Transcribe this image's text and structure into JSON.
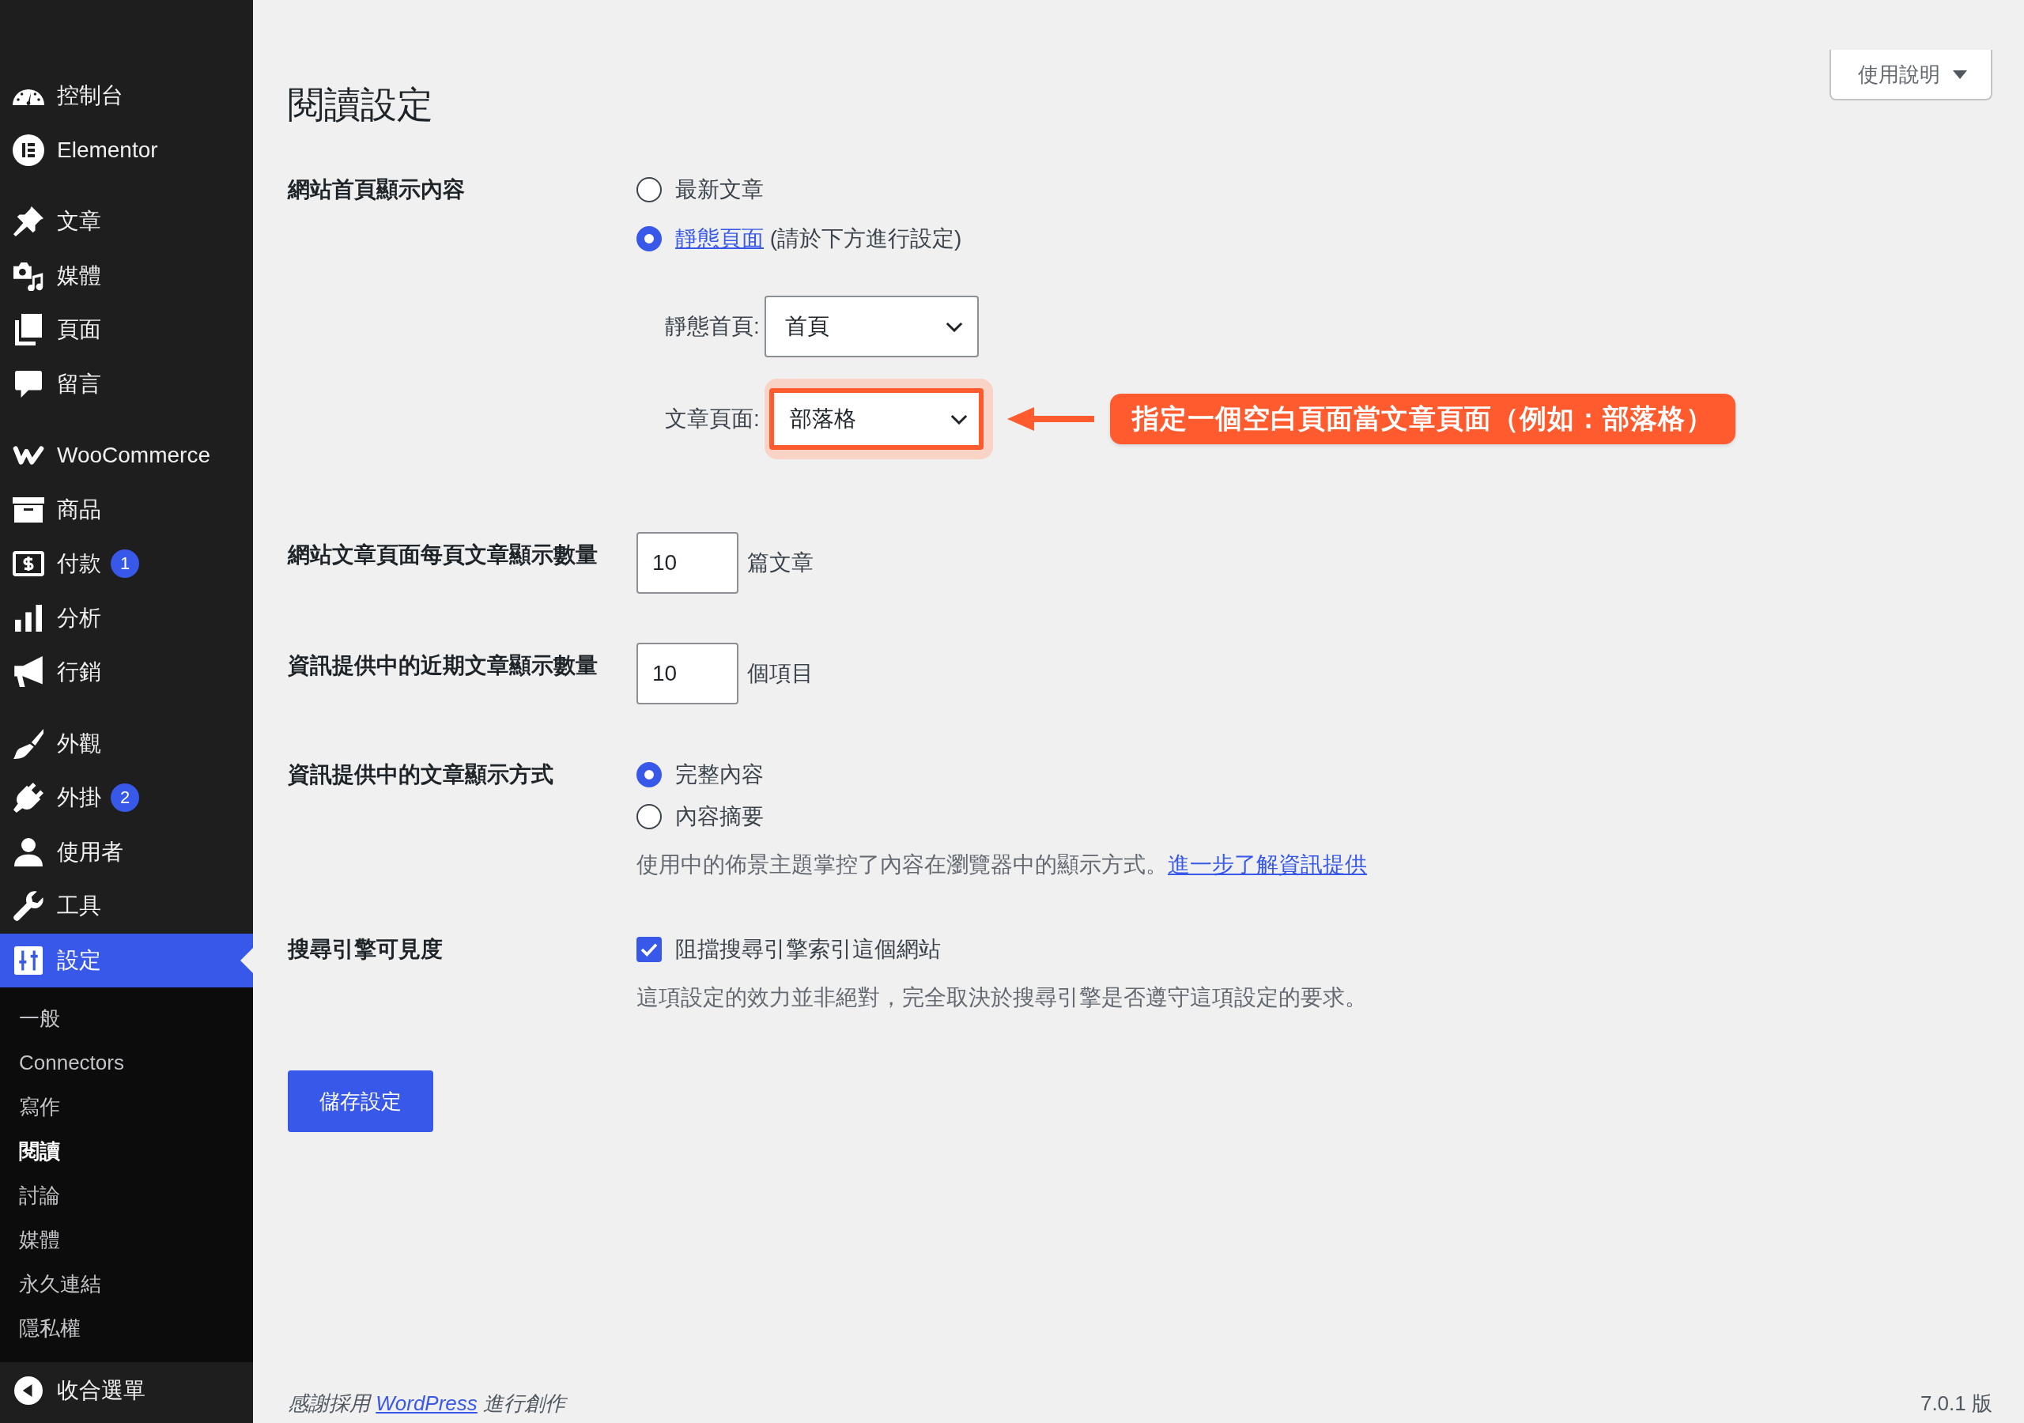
{
  "sidebar": {
    "groups": [
      {
        "items": [
          {
            "label": "控制台",
            "selected": false
          },
          {
            "label": "Elementor",
            "selected": false
          }
        ]
      },
      {
        "items": [
          {
            "label": "文章",
            "selected": false
          },
          {
            "label": "媒體",
            "selected": false
          },
          {
            "label": "頁面",
            "selected": false
          },
          {
            "label": "留言",
            "selected": false
          }
        ]
      },
      {
        "items": [
          {
            "label": "WooCommerce",
            "selected": false
          },
          {
            "label": "商品",
            "selected": false
          },
          {
            "label": "付款",
            "selected": false,
            "badge": "1"
          },
          {
            "label": "分析",
            "selected": false
          },
          {
            "label": "行銷",
            "selected": false
          }
        ]
      },
      {
        "items": [
          {
            "label": "外觀",
            "selected": false
          },
          {
            "label": "外掛",
            "selected": false,
            "badge": "2"
          },
          {
            "label": "使用者",
            "selected": false
          },
          {
            "label": "工具",
            "selected": false
          },
          {
            "label": "設定",
            "selected": true,
            "children": [
              {
                "label": "一般",
                "selected": false
              },
              {
                "label": "Connectors",
                "selected": false
              },
              {
                "label": "寫作",
                "selected": false
              },
              {
                "label": "閱讀",
                "selected": true
              },
              {
                "label": "討論",
                "selected": false
              },
              {
                "label": "媒體",
                "selected": false
              },
              {
                "label": "永久連結",
                "selected": false
              },
              {
                "label": "隱私權",
                "selected": false
              }
            ]
          }
        ]
      }
    ],
    "collapse_button": "收合選單"
  },
  "help_button": "使用說明",
  "page_title": "閱讀設定",
  "settings": [
    {
      "kind": "front_page",
      "label": "網站首頁顯示內容",
      "options": [
        {
          "text": "最新文章",
          "selected": false
        },
        {
          "link": "靜態頁面",
          "text": "(請於下方進行設定)",
          "selected": true
        }
      ],
      "selects": [
        {
          "label": "靜態首頁:",
          "value": "首頁",
          "highlighted": false
        },
        {
          "label": "文章頁面:",
          "value": "部落格",
          "highlighted": true,
          "callout": "指定一個空白頁面當文章頁面（例如：部落格）"
        }
      ]
    },
    {
      "kind": "number",
      "label": "網站文章頁面每頁文章顯示數量",
      "value": "10",
      "unit": "篇文章"
    },
    {
      "kind": "number",
      "label": "資訊提供中的近期文章顯示數量",
      "value": "10",
      "unit": "個項目"
    },
    {
      "kind": "radio_group",
      "label": "資訊提供中的文章顯示方式",
      "options": [
        {
          "text": "完整內容",
          "selected": true
        },
        {
          "text": "內容摘要",
          "selected": false
        }
      ],
      "description": "使用中的佈景主題掌控了內容在瀏覽器中的顯示方式。",
      "description_link": "進一步了解資訊提供"
    },
    {
      "kind": "checkbox",
      "label": "搜尋引擎可見度",
      "text": "阻擋搜尋引擎索引這個網站",
      "checked": true,
      "description": "這項設定的效力並非絕對，完全取決於搜尋引擎是否遵守這項設定的要求。"
    }
  ],
  "save_button": "儲存設定",
  "footer": {
    "credit_before": "感謝採用",
    "credit_link": "WordPress",
    "credit_after": "進行創作",
    "version": "7.0.1 版"
  }
}
